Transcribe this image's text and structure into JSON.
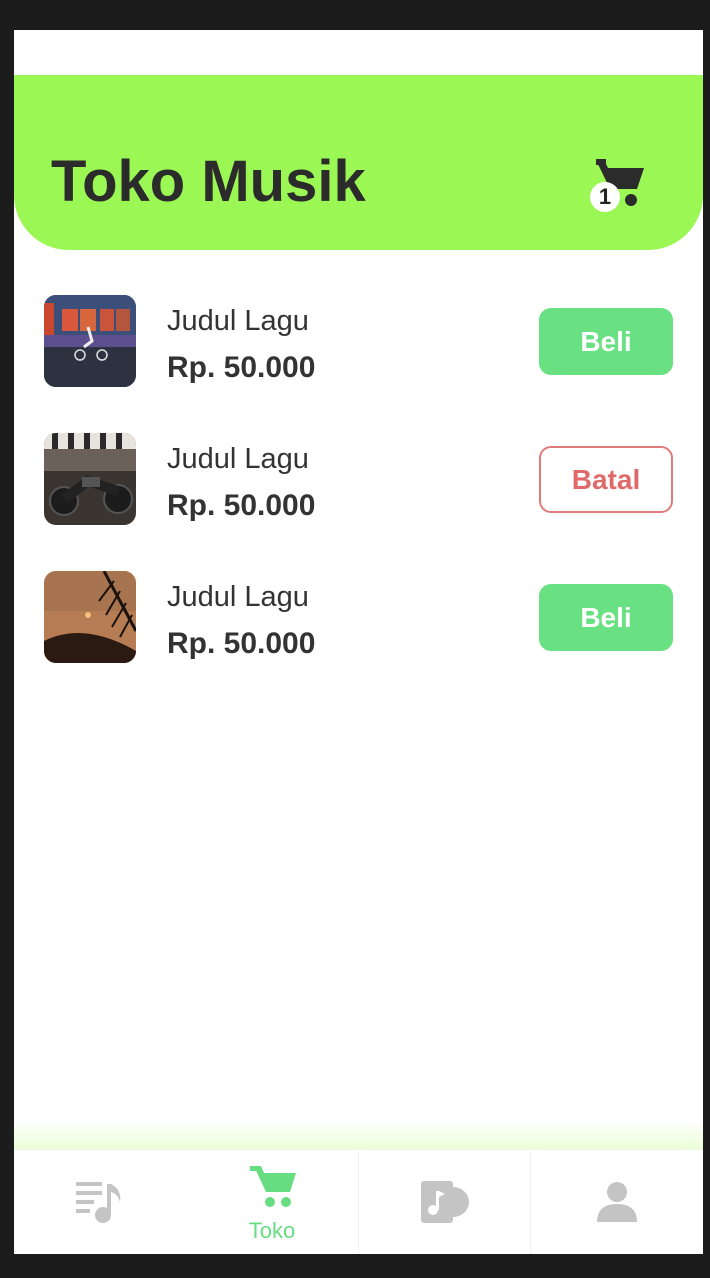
{
  "header": {
    "title": "Toko Musik",
    "cart_icon": "shopping-cart-icon",
    "cart_count": "1"
  },
  "songs": [
    {
      "title": "Judul Lagu",
      "price": "Rp. 50.000",
      "action": "Beli",
      "state": "buy"
    },
    {
      "title": "Judul Lagu",
      "price": "Rp. 50.000",
      "action": "Batal",
      "state": "cancel"
    },
    {
      "title": "Judul Lagu",
      "price": "Rp. 50.000",
      "action": "Beli",
      "state": "buy"
    }
  ],
  "nav": {
    "items": [
      {
        "icon": "playlist-music-icon",
        "label": "",
        "active": false
      },
      {
        "icon": "shopping-cart-icon",
        "label": "Toko",
        "active": true
      },
      {
        "icon": "album-music-icon",
        "label": "",
        "active": false
      },
      {
        "icon": "user-profile-icon",
        "label": "",
        "active": false
      }
    ]
  },
  "colors": {
    "header_bg": "#9bf753",
    "buy_button": "#69e081",
    "cancel_border": "#e07b7b",
    "nav_active": "#66dd80",
    "nav_inactive": "#c4c4c4"
  }
}
